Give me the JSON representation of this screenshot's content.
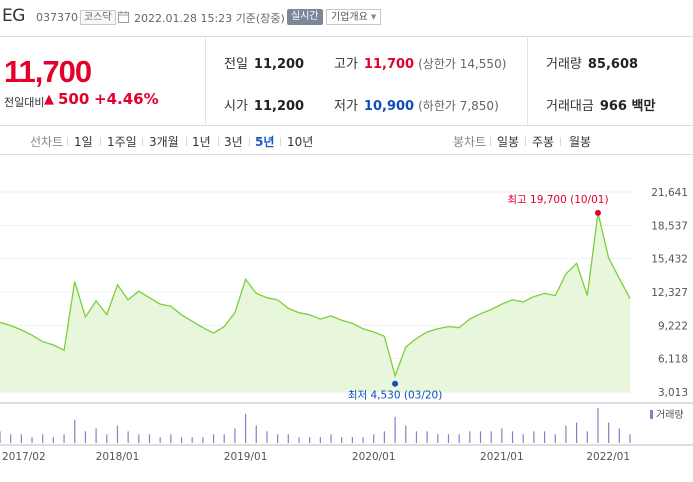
{
  "header": {
    "stock_name": "EG",
    "stock_code": "037370",
    "market": "코스닥",
    "timestamp": "2022.01.28 15:23",
    "basis": "기준(장중)",
    "live_button": "실시간",
    "company_button": "기업개요"
  },
  "quote": {
    "price": "11,700",
    "change_label": "전일대비",
    "change_arrow": "▲",
    "change_value": "500",
    "change_percent": "+4.46%",
    "prev_close_label": "전일",
    "prev_close": "11,200",
    "open_label": "시가",
    "open": "11,200",
    "high_label": "고가",
    "high": "11,700",
    "upper_limit_label": "(상한가 14,550)",
    "low_label": "저가",
    "low": "10,900",
    "lower_limit_label": "(하한가 7,850)",
    "volume_label": "거래량",
    "volume": "85,608",
    "amount_label": "거래대금",
    "amount": "966 백만"
  },
  "tabs": {
    "line_group": "선차트",
    "line": [
      "1일",
      "1주일",
      "3개월",
      "1년",
      "3년",
      "5년",
      "10년"
    ],
    "active": "5년",
    "candle_group": "봉차트",
    "candle": [
      "일봉",
      "주봉",
      "월봉"
    ]
  },
  "colors": {
    "up": "#e4002b",
    "down": "#0d4dbd",
    "line": "#7ccf3a",
    "area": "#e8f7dc",
    "volume": "#8a7fc4"
  },
  "chart_data": {
    "type": "area",
    "x_ticks": [
      "2017/02",
      "2018/01",
      "2019/01",
      "2020/01",
      "2021/01",
      "2022/01"
    ],
    "y_ticks": [
      "21,641",
      "18,537",
      "15,432",
      "12,327",
      "9,222",
      "6,118",
      "3,013"
    ],
    "ylim": [
      3013,
      21641
    ],
    "max_annotation": "최고 19,700 (10/01)",
    "min_annotation": "최저 4,530 (03/20)",
    "volume_legend": "거래량",
    "series": [
      {
        "x": [
          "2017-02",
          "2017-03",
          "2017-04",
          "2017-05",
          "2017-06",
          "2017-07",
          "2017-08",
          "2017-09",
          "2017-10",
          "2017-11",
          "2017-12",
          "2018-01",
          "2018-02",
          "2018-03",
          "2018-04",
          "2018-05",
          "2018-06",
          "2018-07",
          "2018-08",
          "2018-09",
          "2018-10",
          "2018-11",
          "2018-12",
          "2019-01",
          "2019-02",
          "2019-03",
          "2019-04",
          "2019-05",
          "2019-06",
          "2019-07",
          "2019-08",
          "2019-09",
          "2019-10",
          "2019-11",
          "2019-12",
          "2020-01",
          "2020-02",
          "2020-03",
          "2020-04",
          "2020-05",
          "2020-06",
          "2020-07",
          "2020-08",
          "2020-09",
          "2020-10",
          "2020-11",
          "2020-12",
          "2021-01",
          "2021-02",
          "2021-03",
          "2021-04",
          "2021-05",
          "2021-06",
          "2021-07",
          "2021-08",
          "2021-09",
          "2021-10",
          "2021-11",
          "2021-12",
          "2022-01"
        ],
        "values": [
          9500,
          9200,
          8800,
          8300,
          7700,
          7400,
          6900,
          13300,
          10000,
          11500,
          10200,
          13000,
          11600,
          12400,
          11800,
          11200,
          11000,
          10200,
          9600,
          9000,
          8500,
          9100,
          10400,
          13500,
          12200,
          11800,
          11600,
          10800,
          10400,
          10200,
          9800,
          10100,
          9700,
          9400,
          8900,
          8600,
          8200,
          4530,
          7200,
          8000,
          8600,
          8900,
          9100,
          9000,
          9800,
          10300,
          10700,
          11200,
          11600,
          11400,
          11900,
          12200,
          12000,
          14000,
          15000,
          12000,
          19700,
          15500,
          13600,
          11700
        ]
      }
    ],
    "volume": [
      4,
      3,
      3,
      2,
      3,
      2,
      3,
      8,
      4,
      5,
      3,
      6,
      4,
      3,
      3,
      2,
      3,
      2,
      2,
      2,
      3,
      3,
      5,
      10,
      6,
      4,
      3,
      3,
      2,
      2,
      2,
      3,
      2,
      2,
      2,
      3,
      4,
      9,
      6,
      4,
      4,
      3,
      3,
      3,
      4,
      4,
      4,
      5,
      4,
      3,
      4,
      4,
      3,
      6,
      7,
      4,
      12,
      7,
      5,
      3
    ]
  }
}
